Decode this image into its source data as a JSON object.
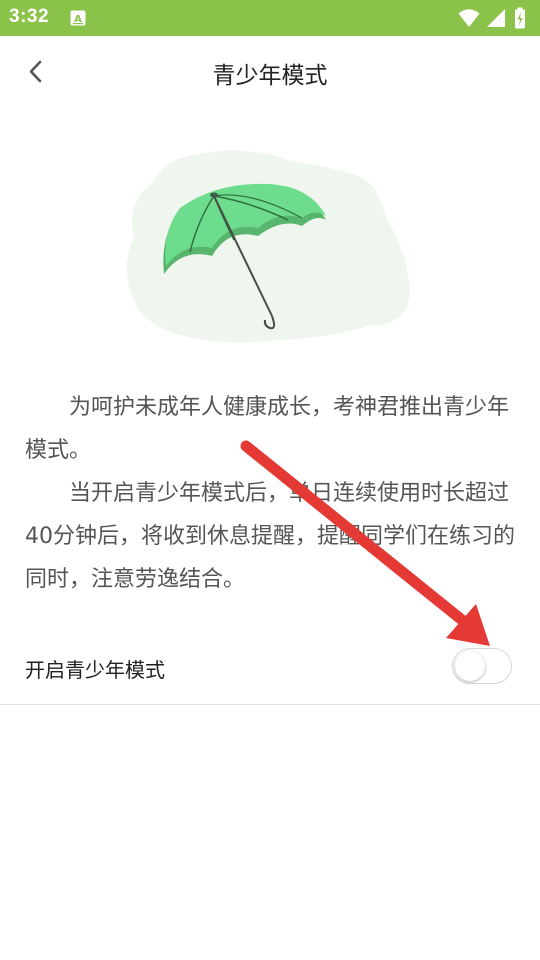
{
  "status_bar": {
    "time": "3:32",
    "icons": [
      "app-notification-icon",
      "wifi-icon",
      "cell-signal-icon",
      "battery-icon"
    ],
    "bg_color": "#8bc34a"
  },
  "header": {
    "title": "青少年模式",
    "back_icon": "chevron-left-icon"
  },
  "illustration": {
    "icon": "umbrella-icon",
    "umbrella_color": "#6ddc8c",
    "umbrella_shade": "#57b56e",
    "blob_color": "#eef6ee"
  },
  "description": {
    "paragraph1": "为呵护未成年人健康成长，考神君推出青少年模式。",
    "paragraph2": "当开启青少年模式后，单日连续使用时长超过40分钟后，将收到休息提醒，提醒同学们在练习的同时，注意劳逸结合。"
  },
  "setting": {
    "label": "开启青少年模式",
    "enabled": false
  },
  "annotation": {
    "icon": "red-arrow-icon",
    "color": "#e53935"
  }
}
